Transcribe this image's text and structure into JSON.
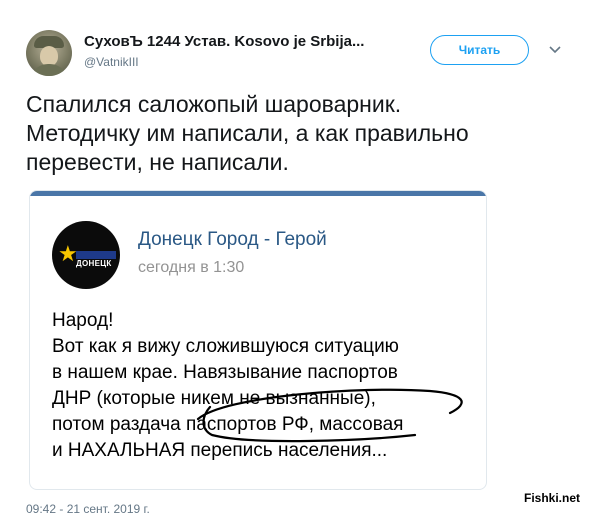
{
  "tweet": {
    "display_name": "СуховЪ 1244 Устав. Kosovo je Srbija...",
    "handle": "@VatnikIII",
    "follow_label": "Читать",
    "text_lines": [
      "Спалился саложопый шароварник.",
      "Методичку им написали, а как правильно",
      "перевести, не написали."
    ],
    "footer_date": "09:42 - 21 сент. 2019 г."
  },
  "card": {
    "accent_color": "#4a76a8",
    "logo_text": "ДОНЕЦК",
    "group_name": "Донецк Город - Герой",
    "post_time": "сегодня в 1:30",
    "post_lines": [
      "Народ!",
      "Вот как я вижу сложившуюся ситуацию",
      "в нашем крае. Навязывание паспортов",
      "ДНР (которые никем не вызнанные),",
      "потом раздача паспортов РФ, массовая",
      "и НАХАЛЬНАЯ перепись населения..."
    ]
  },
  "watermark": "Fishki.net",
  "icons": {
    "caret": "chevron-down-icon",
    "star": "star-icon"
  }
}
